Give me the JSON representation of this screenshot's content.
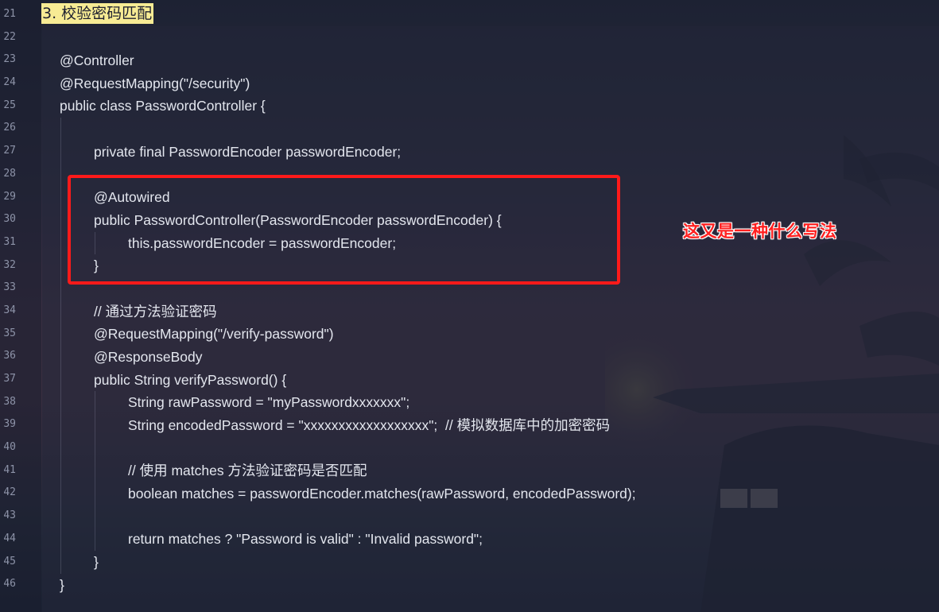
{
  "heading": "3. 校验密码匹配",
  "annotation": "这又是一种什么写法",
  "colors": {
    "heading_bg": "#f7eb94",
    "highlight_border": "#ff1a1a",
    "annotation": "#ff2020",
    "code_text": "#e3e6ee",
    "line_number": "#8d93a8"
  },
  "line_numbers": [
    "21",
    "22",
    "23",
    "24",
    "25",
    "26",
    "27",
    "28",
    "29",
    "30",
    "31",
    "32",
    "33",
    "34",
    "35",
    "36",
    "37",
    "38",
    "39",
    "40",
    "41",
    "42",
    "43",
    "44",
    "45",
    "46"
  ],
  "code_lines": [
    {
      "indent": 0,
      "text": "@Controller"
    },
    {
      "indent": 0,
      "text": "@RequestMapping(\"/security\")"
    },
    {
      "indent": 0,
      "text": "public class PasswordController {"
    },
    {
      "indent": 1,
      "text": ""
    },
    {
      "indent": 1,
      "text": "private final PasswordEncoder passwordEncoder;"
    },
    {
      "indent": 1,
      "text": ""
    },
    {
      "indent": 1,
      "text": "@Autowired"
    },
    {
      "indent": 1,
      "text": "public PasswordController(PasswordEncoder passwordEncoder) {"
    },
    {
      "indent": 2,
      "text": "this.passwordEncoder = passwordEncoder;"
    },
    {
      "indent": 1,
      "text": "}"
    },
    {
      "indent": 1,
      "text": ""
    },
    {
      "indent": 1,
      "text": "// 通过方法验证密码"
    },
    {
      "indent": 1,
      "text": "@RequestMapping(\"/verify-password\")"
    },
    {
      "indent": 1,
      "text": "@ResponseBody"
    },
    {
      "indent": 1,
      "text": "public String verifyPassword() {"
    },
    {
      "indent": 2,
      "text": "String rawPassword = \"myPasswordxxxxxxx\";"
    },
    {
      "indent": 2,
      "text": "String encodedPassword = \"xxxxxxxxxxxxxxxxxx\";  // 模拟数据库中的加密密码"
    },
    {
      "indent": 2,
      "text": ""
    },
    {
      "indent": 2,
      "text": "// 使用 matches 方法验证密码是否匹配"
    },
    {
      "indent": 2,
      "text": "boolean matches = passwordEncoder.matches(rawPassword, encodedPassword);"
    },
    {
      "indent": 2,
      "text": ""
    },
    {
      "indent": 2,
      "text": "return matches ? \"Password is valid\" : \"Invalid password\";"
    },
    {
      "indent": 1,
      "text": "}"
    },
    {
      "indent": 0,
      "text": "}"
    }
  ]
}
